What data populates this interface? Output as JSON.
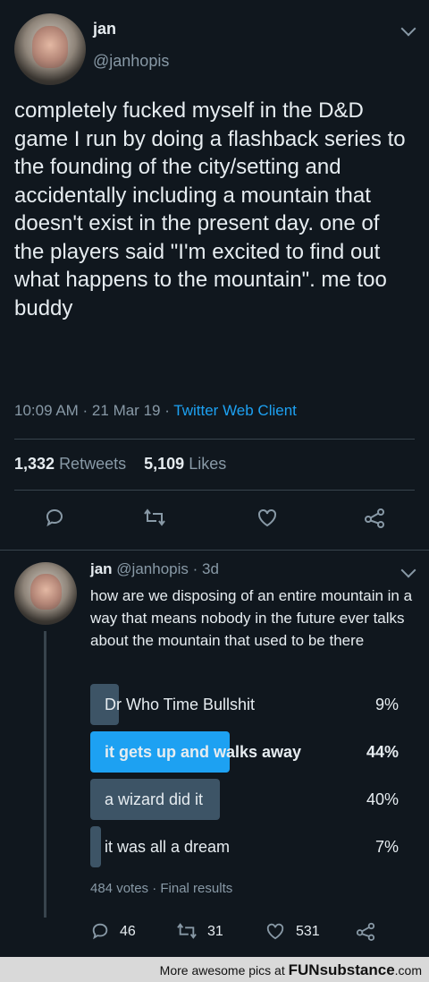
{
  "tweet": {
    "name": "jan",
    "handle": "@janhopis",
    "text": "completely fucked myself in the D&D game I run by doing a flashback series to the founding of the city/setting and accidentally including a mountain that doesn't exist in the present day. one of the players said \"I'm excited to find out what happens to the mountain\". me too buddy",
    "time": "10:09 AM · 21 Mar 19 · ",
    "client": "Twitter Web Client",
    "retweets_count": "1,332",
    "retweets_label": "Retweets",
    "likes_count": "5,109",
    "likes_label": "Likes"
  },
  "reply": {
    "name": "jan",
    "handle_time": "@janhopis · 3d",
    "text": "how are we disposing of an entire mountain in a way that means nobody in the future ever talks about the mountain that used to be there",
    "poll": {
      "options": [
        {
          "label": "Dr Who Time Bullshit",
          "percent_text": "9%",
          "percent": 9,
          "winner": false
        },
        {
          "label": "it gets up and walks away",
          "percent_text": "44%",
          "percent": 44,
          "winner": true
        },
        {
          "label": "a wizard did it",
          "percent_text": "40%",
          "percent": 40,
          "winner": false
        },
        {
          "label": "it was all a dream",
          "percent_text": "7%",
          "percent": 7,
          "winner": false
        }
      ],
      "meta": "484 votes · Final results"
    },
    "replies_count": "46",
    "retweets_count": "31",
    "likes_count": "531"
  },
  "footer": {
    "text": "More awesome pics at",
    "brand": "FUNsubstance",
    "tld": ".com"
  },
  "colors": {
    "background": "#10171e",
    "accent": "#1da1f2",
    "poll_bar": "#3d5466",
    "muted": "#8899a6"
  }
}
